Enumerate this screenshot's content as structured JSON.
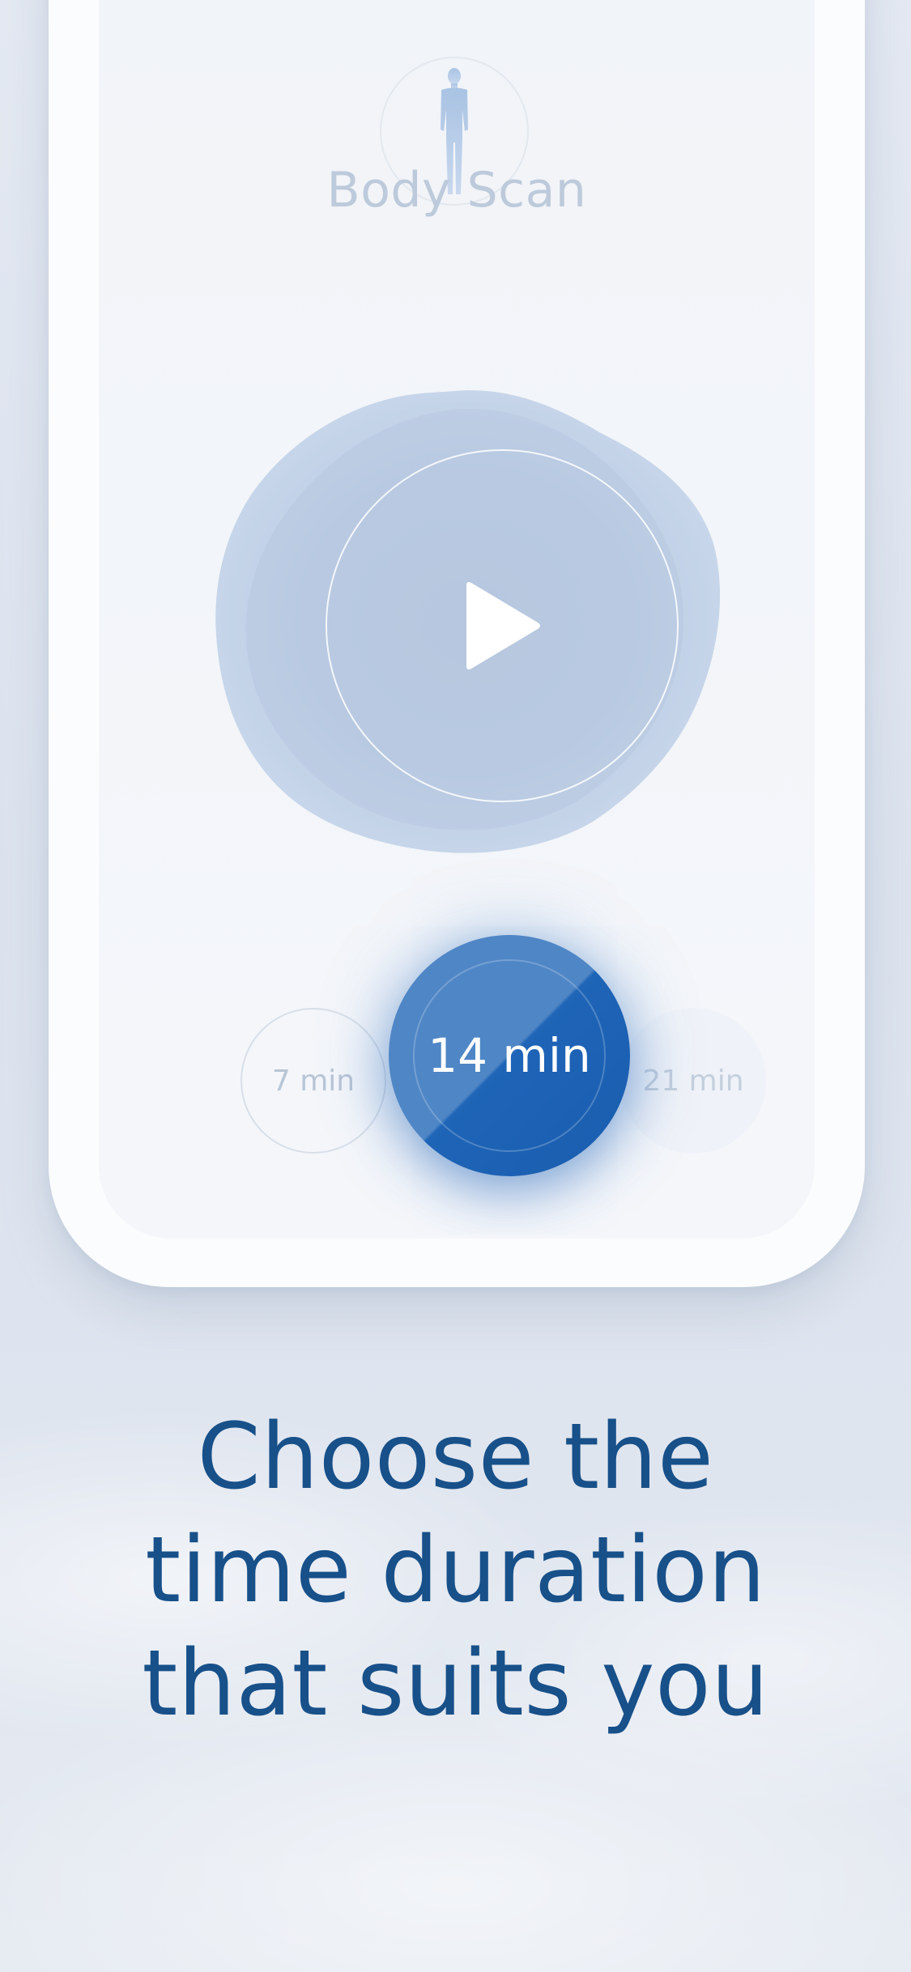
{
  "screen": {
    "title": "Body Scan",
    "play_icon": "play-icon",
    "avatar_icon": "human-figure-icon"
  },
  "durations": {
    "options": [
      {
        "label": "7 min",
        "selected": false
      },
      {
        "label": "14 min",
        "selected": true
      },
      {
        "label": "21 min",
        "selected": false
      }
    ]
  },
  "caption": {
    "lines": [
      "Choose the",
      "time duration",
      "that suits you"
    ]
  },
  "colors": {
    "accent": "#1e64b7",
    "accent_light": "#4f86c6",
    "caption": "#185089",
    "muted_title": "#bdcadb"
  }
}
